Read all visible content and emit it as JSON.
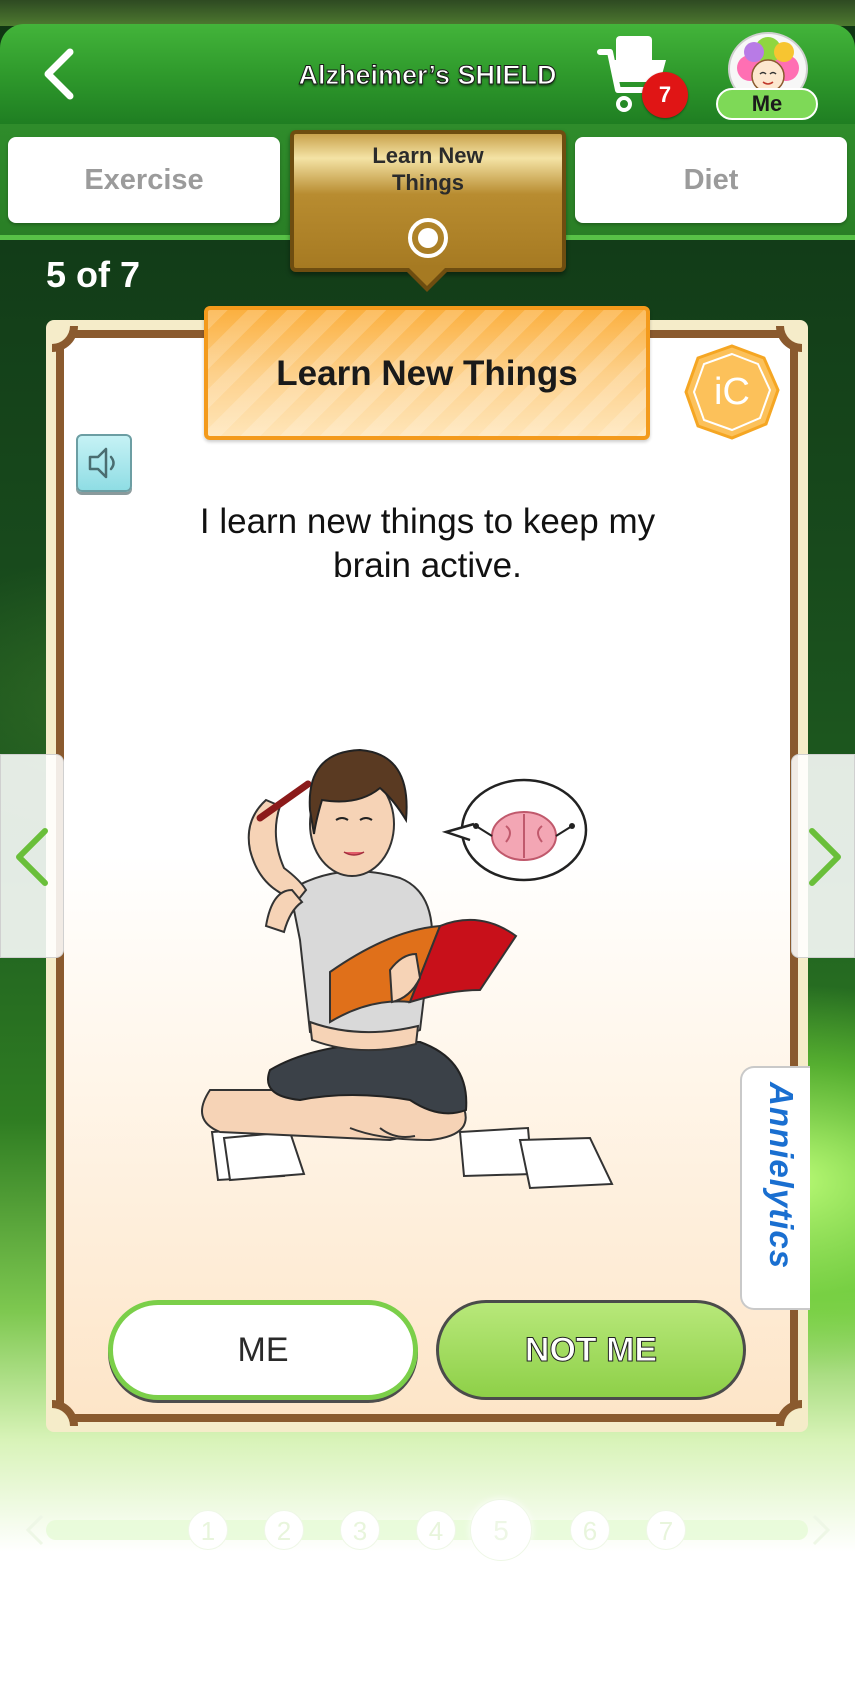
{
  "header": {
    "title": "Alzheimer’s SHIELD",
    "cart_count": "7",
    "profile_label": "Me"
  },
  "tabs": [
    {
      "label": "Exercise",
      "active": false
    },
    {
      "label": "Learn New Things",
      "active": true
    },
    {
      "label": "Diet",
      "active": false
    }
  ],
  "active_tab_lines": [
    "Learn New",
    "Things"
  ],
  "counter": "5 of 7",
  "card": {
    "title": "Learn New Things",
    "badge_text": "iC",
    "statement_lines": [
      "I learn new things to keep my",
      "brain active."
    ]
  },
  "side_tab_brand": "Annielytics",
  "buttons": {
    "me": "ME",
    "not_me": "NOT ME"
  },
  "pagination": {
    "pages": [
      "1",
      "2",
      "3",
      "4",
      "5",
      "6",
      "7"
    ],
    "current": "5"
  },
  "icons": [
    "back-arrow-icon",
    "shopping-cart-icon",
    "flower-avatar-icon",
    "radio-target-icon",
    "speaker-icon",
    "chevron-left-icon",
    "chevron-right-icon"
  ],
  "colors": {
    "header_green": "#2f9a2c",
    "active_tab_gold": "#b88c30",
    "banner_orange": "#fbb040",
    "frame_brown": "#8a5a2e",
    "not_me_green": "#8ed048",
    "badge_red": "#e01515"
  }
}
